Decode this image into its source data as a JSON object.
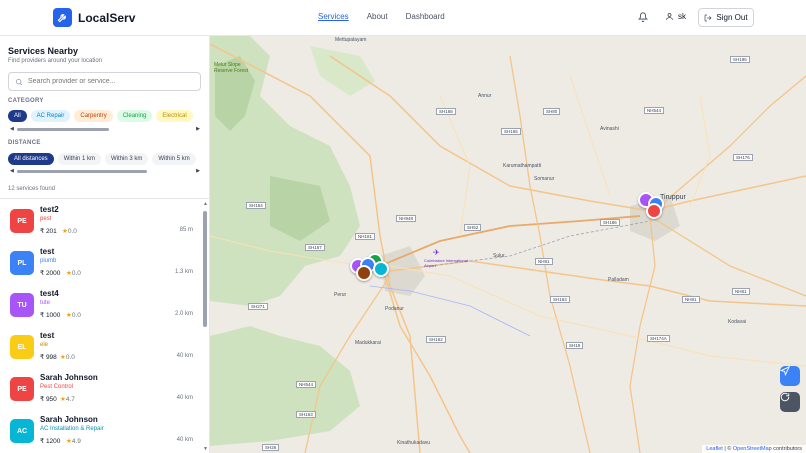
{
  "app": {
    "name": "LocalServ",
    "brand_color": "#2563eb"
  },
  "nav": {
    "items": [
      "Services",
      "About",
      "Dashboard"
    ],
    "active": "Services"
  },
  "user": {
    "name": "sk",
    "sign_out": "Sign Out"
  },
  "sidebar": {
    "title": "Services Nearby",
    "subtitle": "Find providers around your location",
    "search_placeholder": "Search provider or service...",
    "category_label": "CATEGORY",
    "categories": [
      "All",
      "AC Repair",
      "Carpentry",
      "Cleaning",
      "Electrical"
    ],
    "distance_label": "DISTANCE",
    "distances": [
      "All distances",
      "Within 1 km",
      "Within 3 km",
      "Within 5 km"
    ],
    "count_text": "12 services found"
  },
  "services": [
    {
      "initials": "PE",
      "name": "test2",
      "category": "pest",
      "price": "₹ 201",
      "rating": "0.0",
      "distance": "85 m",
      "color": "#ef4444"
    },
    {
      "initials": "PL",
      "name": "test",
      "category": "plumb",
      "price": "₹ 2000",
      "rating": "0.0",
      "distance": "1.3 km",
      "color": "#3b82f6"
    },
    {
      "initials": "TU",
      "name": "test4",
      "category": "tute",
      "price": "₹ 1000",
      "rating": "0.0",
      "distance": "2.0 km",
      "color": "#a855f7"
    },
    {
      "initials": "EL",
      "name": "test",
      "category": "ele",
      "price": "₹ 998",
      "rating": "0.0",
      "distance": "40 km",
      "color": "#facc15"
    },
    {
      "initials": "PE",
      "name": "Sarah Johnson",
      "category": "Pest Control",
      "price": "₹ 950",
      "rating": "4.7",
      "distance": "40 km",
      "color": "#ef4444"
    },
    {
      "initials": "AC",
      "name": "Sarah Johnson",
      "category": "AC Installation & Repair",
      "price": "₹ 1200",
      "rating": "4.9",
      "distance": "40 km",
      "color": "#06b6d4"
    }
  ],
  "map": {
    "labels": {
      "mettupalayam": "Mettupalayam",
      "annur": "Annur",
      "avinashi": "Avinashi",
      "tiruppur": "Tiruppur",
      "karumathampatti": "Karumathampatti",
      "somanur": "Somanur",
      "sulur": "Sulur",
      "palladam": "Palladam",
      "perur": "Perur",
      "podanur": "Podanur",
      "madukkarai": "Madukkarai",
      "kinathukadavu": "Kinathukadavu",
      "kodavai": "Kodavai",
      "forest": "Melur Slope Reserve Forest",
      "airport": "Coimbatore International Airport"
    },
    "shields": [
      "SH196",
      "SH80",
      "SH168",
      "SH165",
      "NH544",
      "SH176",
      "SH164",
      "NH948",
      "NH181",
      "SH52",
      "NH81",
      "SH167",
      "SH271",
      "SH162",
      "SH163",
      "SH19",
      "SH174A",
      "NH544",
      "SH163",
      "SH26",
      "NH81",
      "NH81",
      "SH186"
    ],
    "attribution_leaflet": "Leaflet",
    "attribution_sep": "| ©",
    "attribution_osm": "OpenStreetMap",
    "attribution_tail": "contributors",
    "marker_colors": [
      "#a855f7",
      "#3b82f6",
      "#ef4444",
      "#16a34a",
      "#06b6d4",
      "#92400e",
      "#facc15"
    ],
    "locate_color": "#3b82f6",
    "refresh_color": "#4b5563"
  }
}
